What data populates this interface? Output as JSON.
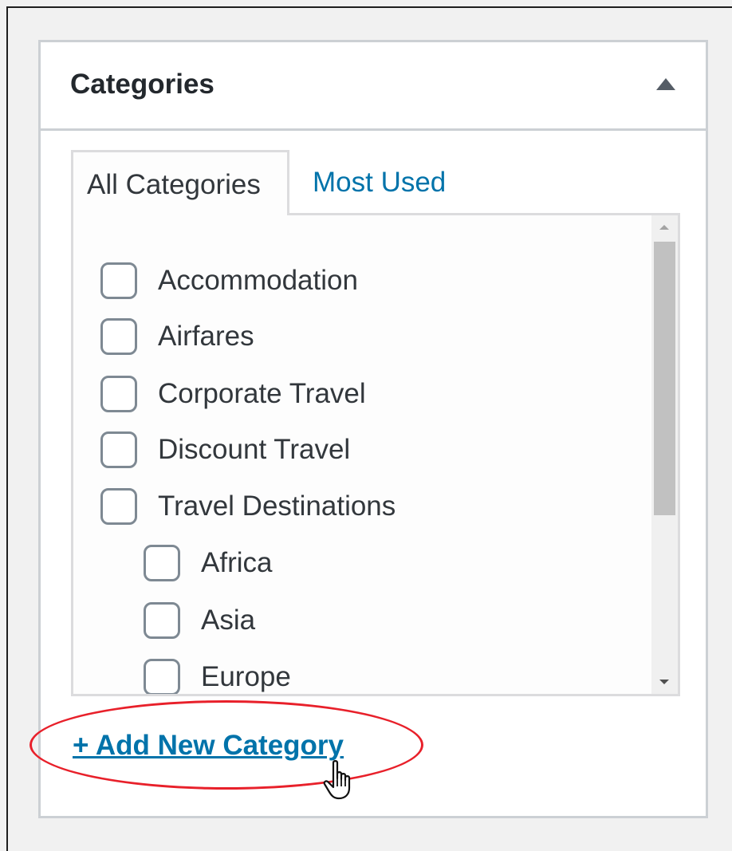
{
  "postbox": {
    "title": "Categories",
    "toggle_icon": "triangle-up-icon"
  },
  "tabs": [
    {
      "label": "All Categories",
      "active": true
    },
    {
      "label": "Most Used",
      "active": false
    }
  ],
  "categories": [
    {
      "label": "Accommodation",
      "checked": false,
      "level": 0
    },
    {
      "label": "Airfares",
      "checked": false,
      "level": 0
    },
    {
      "label": "Corporate Travel",
      "checked": false,
      "level": 0
    },
    {
      "label": "Discount Travel",
      "checked": false,
      "level": 0
    },
    {
      "label": "Travel Destinations",
      "checked": false,
      "level": 0
    },
    {
      "label": "Africa",
      "checked": false,
      "level": 1
    },
    {
      "label": "Asia",
      "checked": false,
      "level": 1
    },
    {
      "label": "Europe",
      "checked": false,
      "level": 1
    }
  ],
  "add_new": {
    "label": "+ Add New Category"
  },
  "annotation": {
    "color": "#e8202a",
    "cursor_icon": "hand-pointer-icon"
  },
  "colors": {
    "link": "#0073aa",
    "border": "#ccd0d4",
    "text": "#32373c"
  }
}
